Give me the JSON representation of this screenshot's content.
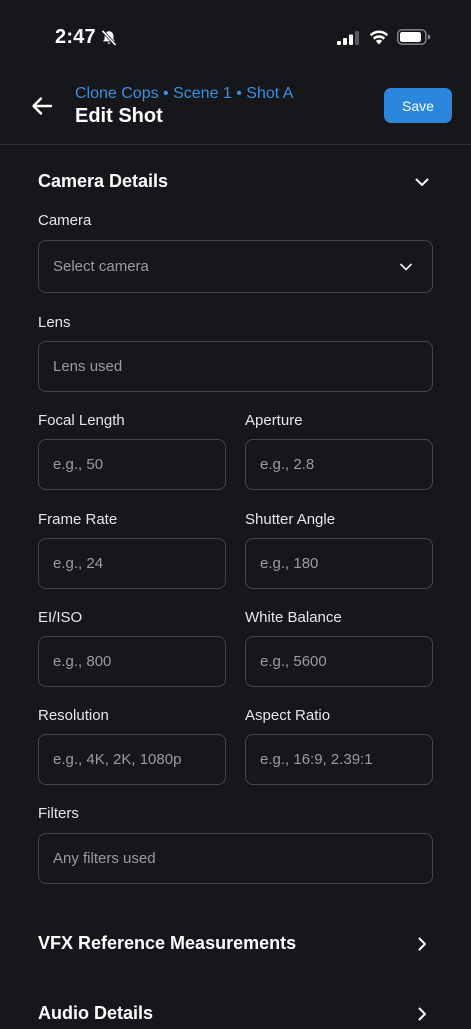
{
  "status_bar": {
    "time": "2:47",
    "icons": [
      "bell-slash-icon",
      "cellular-signal-icon",
      "wifi-icon",
      "battery-icon"
    ]
  },
  "header": {
    "breadcrumb": "Clone Cops • Scene 1 • Shot A",
    "title": "Edit Shot",
    "save_label": "Save",
    "back_icon": "arrow-left-icon",
    "accent_color": "#2b87dc",
    "breadcrumb_color": "#3b8fe0"
  },
  "camera_details": {
    "title": "Camera Details",
    "expanded": true,
    "fields": {
      "camera": {
        "label": "Camera",
        "placeholder": "Select camera"
      },
      "lens": {
        "label": "Lens",
        "placeholder": "Lens used"
      },
      "focal_length": {
        "label": "Focal Length",
        "placeholder": "e.g., 50"
      },
      "aperture": {
        "label": "Aperture",
        "placeholder": "e.g., 2.8"
      },
      "frame_rate": {
        "label": "Frame Rate",
        "placeholder": "e.g., 24"
      },
      "shutter_angle": {
        "label": "Shutter Angle",
        "placeholder": "e.g., 180"
      },
      "ei_iso": {
        "label": "EI/ISO",
        "placeholder": "e.g., 800"
      },
      "white_balance": {
        "label": "White Balance",
        "placeholder": "e.g., 5600"
      },
      "resolution": {
        "label": "Resolution",
        "placeholder": "e.g., 4K, 2K, 1080p"
      },
      "aspect_ratio": {
        "label": "Aspect Ratio",
        "placeholder": "e.g., 16:9, 2.39:1"
      },
      "filters": {
        "label": "Filters",
        "placeholder": "Any filters used"
      }
    }
  },
  "collapsed_sections": [
    {
      "title": "VFX Reference Measurements",
      "expanded": false
    },
    {
      "title": "Audio Details",
      "expanded": false
    }
  ]
}
